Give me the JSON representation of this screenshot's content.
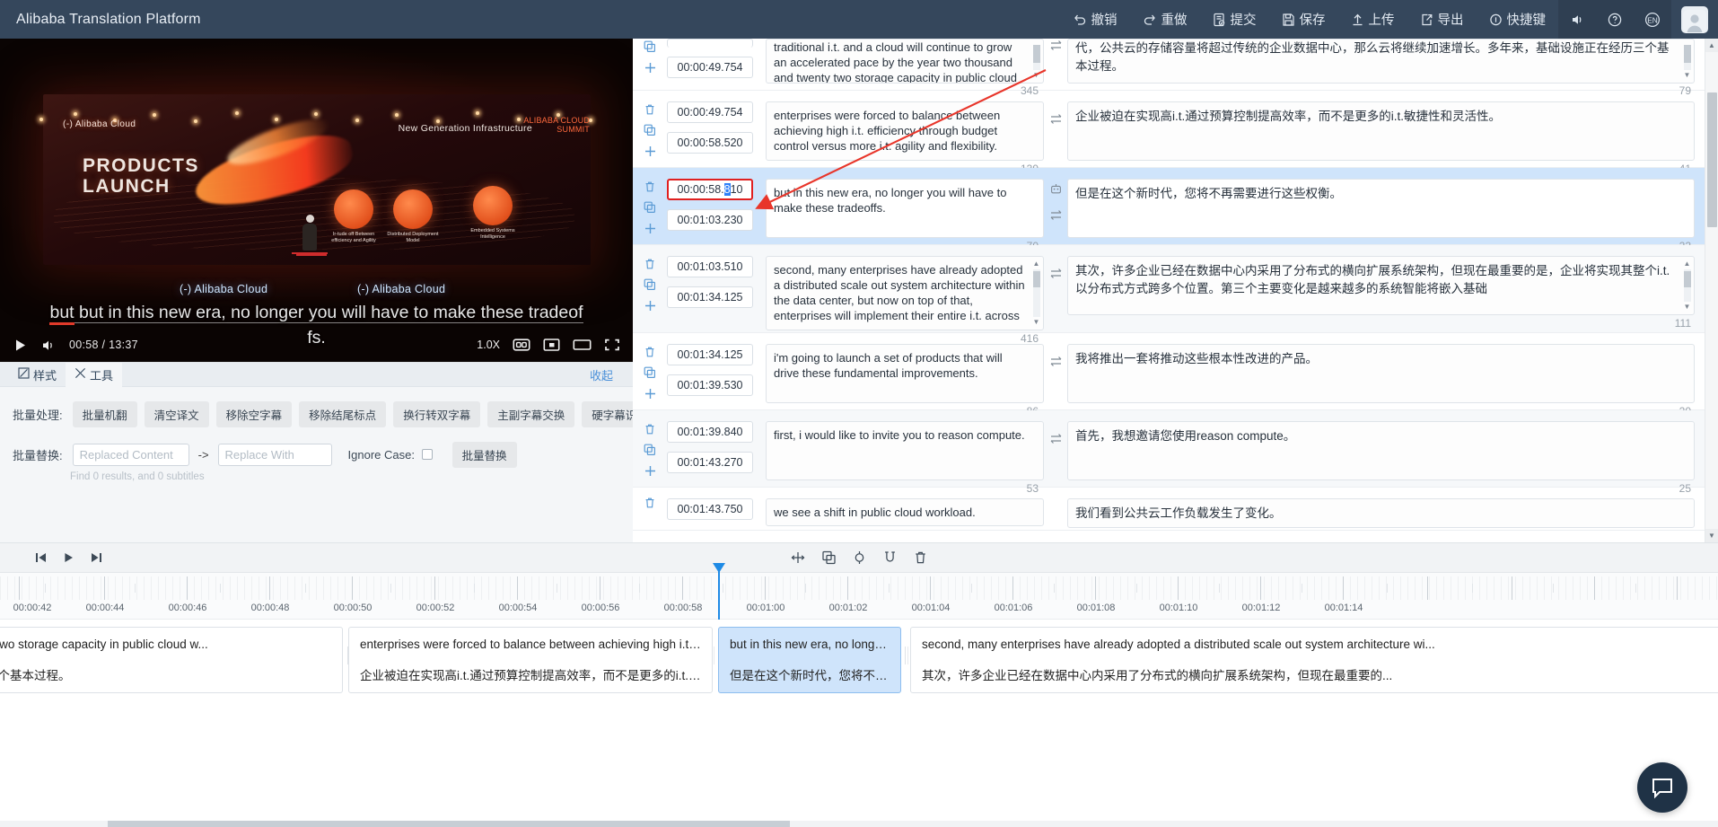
{
  "app": {
    "title": "Alibaba Translation Platform"
  },
  "topbar": {
    "menu": [
      {
        "label": "撤销",
        "icon": "undo-icon"
      },
      {
        "label": "重做",
        "icon": "redo-icon"
      },
      {
        "label": "提交",
        "icon": "submit-icon"
      },
      {
        "label": "保存",
        "icon": "save-icon"
      },
      {
        "label": "上传",
        "icon": "upload-icon"
      },
      {
        "label": "导出",
        "icon": "export-icon"
      },
      {
        "label": "快捷键",
        "icon": "shortcut-icon"
      }
    ],
    "icons": [
      {
        "name": "sound-icon",
        "label": ""
      },
      {
        "name": "help-icon",
        "label": ""
      },
      {
        "name": "language-icon",
        "label": "EN"
      }
    ]
  },
  "video": {
    "subtitle_line1": "but in this new era, no longer you will have to make these tradeof",
    "subtitle_line2": "fs.",
    "current_time": "00:58",
    "duration": "13:37",
    "time_display": "00:58 / 13:37",
    "speed": "1.0X",
    "stage": {
      "brand_top": "(-) Alibaba Cloud",
      "title_line1": "PRODUCTS",
      "title_line2": "LAUNCH",
      "newgen": "New Generation Infrastructure",
      "summit": "ALIBABA CLOUD\nSUMMIT",
      "floor_left": "(-) Alibaba Cloud",
      "floor_right": "(-) Alibaba Cloud",
      "icon_caps": [
        "Ir-tude off Between\nefficiency and Agility",
        "Distributed\nDeployment Model",
        "Embedded\nSystems Intelligence"
      ]
    },
    "controls": {
      "play": "play-icon",
      "volume": "volume-icon",
      "cc": "cc-icon",
      "pip": "pip-icon",
      "theater": "theater-icon",
      "fullscreen": "fullscreen-icon"
    }
  },
  "tools": {
    "tabs": [
      {
        "label": "样式",
        "icon": "style-icon",
        "active": false
      },
      {
        "label": "工具",
        "icon": "tools-icon",
        "active": true
      }
    ],
    "collapse_label": "收起",
    "batch_process_label": "批量处理:",
    "batch_buttons": [
      "批量机翻",
      "清空译文",
      "移除空字幕",
      "移除结尾标点",
      "换行转双字幕",
      "主副字幕交换",
      "硬字幕识别"
    ],
    "batch_replace_label": "批量替换:",
    "replaced_placeholder": "Replaced Content",
    "replaced_value": "",
    "arrow": "->",
    "replace_with_placeholder": "Replace With",
    "replace_with_value": "",
    "ignore_case_label": "Ignore Case:",
    "ignore_case_checked": false,
    "replace_button": "批量替换",
    "find_hint": "Find 0 results, and 0 subtitles"
  },
  "subtitles": {
    "rows": [
      {
        "start": "",
        "end": "00:00:49.754",
        "source": "traditional i.t. and a cloud will continue to grow an accelerated pace by the year two thousand and twenty two storage capacity in public cloud",
        "target": "代，公共云的存储容量将超过传统的企业数据中心，那么云将继续加速增长。多年来，基础设施正在经历三个基本过程。",
        "src_count": "345",
        "tgt_count": "79",
        "selected": false,
        "partial_top": true,
        "src_scroll": true,
        "tgt_scroll": true,
        "has_delete": false
      },
      {
        "start": "00:00:49.754",
        "end": "00:00:58.520",
        "source": "enterprises were forced to balance between achieving high i.t. efficiency through budget control versus more i.t. agility and flexibility.",
        "target": "企业被迫在实现高i.t.通过预算控制提高效率，而不是更多的i.t.敏捷性和灵活性。",
        "src_count": "139",
        "tgt_count": "41",
        "selected": false,
        "src_scroll": false,
        "tgt_scroll": false,
        "has_delete": true
      },
      {
        "start": "00:00:58.810",
        "start_prefix": "00:00:58.",
        "start_hl": "8",
        "start_suffix": "10",
        "end": "00:01:03.230",
        "source": "but in this new era, no longer you will have to make these tradeoffs.",
        "target": "但是在这个新时代，您将不再需要进行这些权衡。",
        "src_count": "70",
        "tgt_count": "22",
        "selected": true,
        "focused": true,
        "src_scroll": false,
        "tgt_scroll": false,
        "has_delete": true
      },
      {
        "start": "00:01:03.510",
        "end": "00:01:34.125",
        "source": "second, many enterprises have already adopted a distributed scale out system architecture within the data center, but now on top of that, enterprises will implement their entire i.t. across",
        "target": "其次，许多企业已经在数据中心内采用了分布式的横向扩展系统架构，但现在最重要的是，企业将实现其整个i.t.以分布式方式跨多个位置。第三个主要变化是越来越多的系统智能将嵌入基础",
        "src_count": "416",
        "tgt_count": "111",
        "selected": false,
        "src_scroll": true,
        "tgt_scroll": true,
        "has_delete": true
      },
      {
        "start": "00:01:34.125",
        "end": "00:01:39.530",
        "source": "i'm going to launch a set of products that will drive these fundamental improvements.",
        "target": "我将推出一套将推动这些根本性改进的产品。",
        "src_count": "86",
        "tgt_count": "20",
        "selected": false,
        "src_scroll": false,
        "tgt_scroll": false,
        "has_delete": true
      },
      {
        "start": "00:01:39.840",
        "end": "00:01:43.270",
        "source": "first, i would like to invite you to reason compute.",
        "target": "首先，我想邀请您使用reason compute。",
        "src_count": "53",
        "tgt_count": "25",
        "selected": false,
        "src_scroll": false,
        "tgt_scroll": false,
        "has_delete": true
      },
      {
        "start": "00:01:43.750",
        "end": "",
        "source": "we see a shift in public cloud workload.",
        "target": "我们看到公共云工作负载发生了变化。",
        "src_count": "",
        "tgt_count": "",
        "selected": false,
        "partial_bottom": true,
        "src_scroll": false,
        "tgt_scroll": false,
        "has_delete": true
      }
    ]
  },
  "timeline": {
    "toolbar_left": [
      {
        "name": "skip-start-icon"
      },
      {
        "name": "play-icon"
      },
      {
        "name": "skip-end-icon"
      }
    ],
    "toolbar_center": [
      {
        "name": "split-move-icon"
      },
      {
        "name": "duplicate-icon"
      },
      {
        "name": "split-icon"
      },
      {
        "name": "merge-icon"
      },
      {
        "name": "delete-icon"
      }
    ],
    "ruler_labels": [
      "00:00:42",
      "00:00:44",
      "00:00:46",
      "00:00:48",
      "00:00:50",
      "00:00:52",
      "00:00:54",
      "00:00:56",
      "00:00:58",
      "00:01:00",
      "00:01:02",
      "00:01:04",
      "00:01:06",
      "00:01:08",
      "00:01:10",
      "00:01:12",
      "00:01:14"
    ],
    "playhead_time": "00:00:58.810",
    "clips": [
      {
        "en": "vo thousand and twenty two storage capacity in public cloud w...",
        "zh": "来，基础设施正在经历三个基本过程。",
        "selected": false
      },
      {
        "en": "enterprises were forced to balance between achieving high i.t. ef...",
        "zh": "企业被迫在实现高i.t.通过预算控制提高效率，而不是更多的i.t.敏...",
        "selected": false
      },
      {
        "en": "but in this new era, no longer ...",
        "zh": "但是在这个新时代，您将不再...",
        "selected": true
      },
      {
        "en": "second, many enterprises have already adopted a distributed scale out system architecture wi...",
        "zh": "其次，许多企业已经在数据中心内采用了分布式的横向扩展系统架构，但现在最重要的...",
        "selected": false
      }
    ],
    "chat_icon": "chat-bubble-icon"
  },
  "colors": {
    "topbar_bg": "#35475c",
    "accent_blue": "#2d7ff9",
    "selection_blue": "#cfe4fb",
    "annotation_red": "#e02020"
  }
}
